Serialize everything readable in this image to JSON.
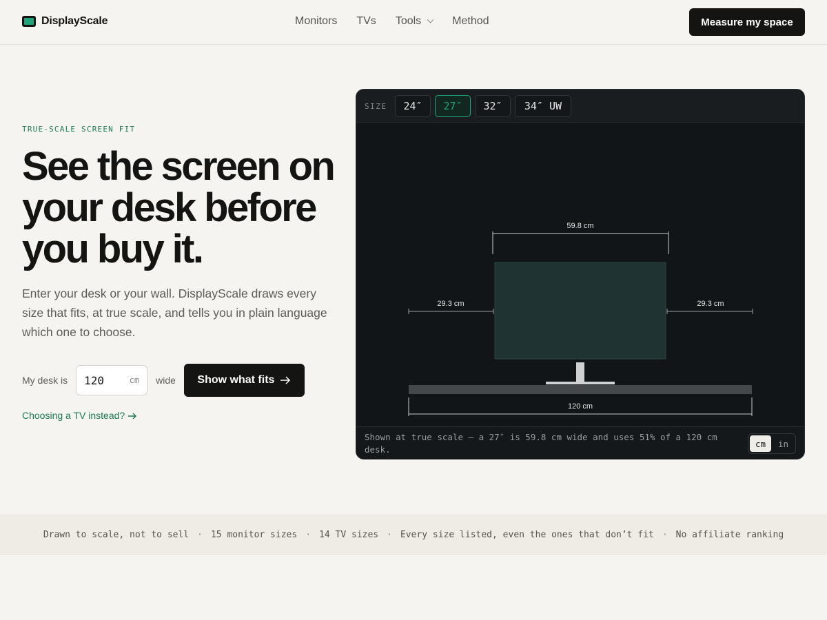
{
  "brand": {
    "name": "DisplayScale"
  },
  "nav": {
    "items": [
      "Monitors",
      "TVs",
      "Tools",
      "Method"
    ],
    "cta": "Measure my space"
  },
  "hero": {
    "eyebrow": "TRUE-SCALE SCREEN FIT",
    "title": "See the screen on your desk before you buy it.",
    "lead": "Enter your desk or your wall. DisplayScale draws every size that fits, at true scale, and tells you in plain language which one to choose.",
    "form": {
      "label": "My desk is",
      "value": "120",
      "unit": "cm",
      "suffix": "wide",
      "submit": "Show what fits"
    },
    "tv_link": "Choosing a TV instead?"
  },
  "preview": {
    "size_label": "SIZE",
    "sizes": [
      "24″",
      "27″",
      "32″",
      "34″ UW"
    ],
    "selected_size": "27″",
    "measurements": {
      "screen_width": "59.8 cm",
      "left_gap": "29.3 cm",
      "right_gap": "29.3 cm",
      "desk_width": "120 cm"
    },
    "caption": "Shown at true scale — a 27″ is 59.8 cm wide and uses 51% of a 120 cm desk.",
    "units": [
      "cm",
      "in"
    ],
    "selected_unit": "cm"
  },
  "strip": {
    "items": [
      "Drawn to scale, not to sell",
      "15 monitor sizes",
      "14 TV sizes",
      "Every size listed, even the ones that don’t fit",
      "No affiliate ranking"
    ]
  },
  "colors": {
    "accent": "#1fa37a",
    "ink": "#141412",
    "panel_bg": "#121517",
    "screen": "#1f3332"
  }
}
